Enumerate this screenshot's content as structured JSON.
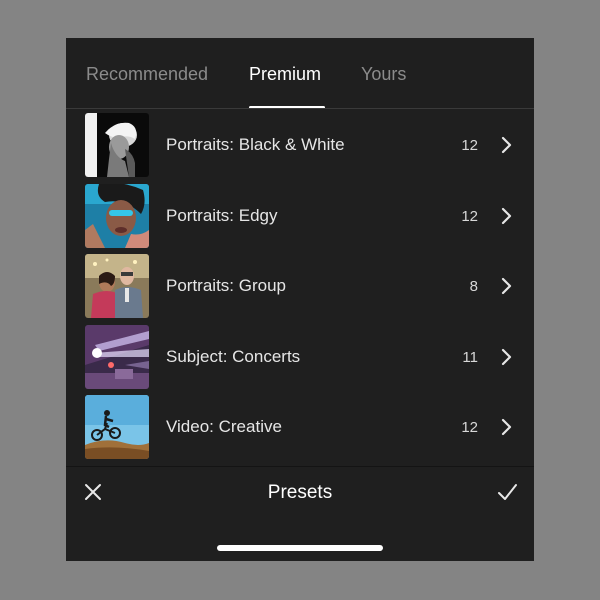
{
  "tabs": [
    {
      "label": "Recommended",
      "active": false
    },
    {
      "label": "Premium",
      "active": true
    },
    {
      "label": "Yours",
      "active": false
    }
  ],
  "presets": [
    {
      "label": "Portraits: Black & White",
      "count": "12",
      "thumb": "bw-portrait"
    },
    {
      "label": "Portraits: Edgy",
      "count": "12",
      "thumb": "edgy-portrait"
    },
    {
      "label": "Portraits: Group",
      "count": "8",
      "thumb": "group-portrait"
    },
    {
      "label": "Subject: Concerts",
      "count": "11",
      "thumb": "concert"
    },
    {
      "label": "Video: Creative",
      "count": "12",
      "thumb": "bike-jump"
    }
  ],
  "bottom_bar": {
    "title": "Presets",
    "close_icon": "close-icon",
    "confirm_icon": "checkmark-icon"
  },
  "colors": {
    "background": "#848484",
    "panel": "#1f1f1f",
    "tab_inactive": "#8b8b8b",
    "tab_active": "#ffffff"
  }
}
